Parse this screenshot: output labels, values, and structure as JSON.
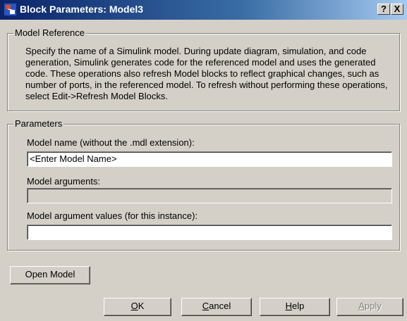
{
  "window": {
    "title": "Block Parameters: Model3",
    "help_button": "?",
    "close_button": "X"
  },
  "model_reference": {
    "legend": "Model Reference",
    "description": "Specify the name of a Simulink model. During update diagram, simulation, and code generation, Simulink generates code for the referenced model and uses the generated code. These operations also refresh Model blocks to reflect graphical changes, such as number of ports, in the referenced model. To refresh without performing these operations, select Edit->Refresh Model Blocks."
  },
  "parameters": {
    "legend": "Parameters",
    "model_name_label": "Model name (without the .mdl extension):",
    "model_name_value": "<Enter Model Name>",
    "model_arguments_label": "Model arguments:",
    "model_arguments_value": "",
    "model_argument_values_label": "Model argument values (for this instance):",
    "model_argument_values_value": ""
  },
  "buttons": {
    "open_model": "Open Model",
    "ok_mnemonic": "O",
    "ok_rest": "K",
    "cancel_mnemonic": "C",
    "cancel_rest": "ancel",
    "help_mnemonic": "H",
    "help_rest": "elp",
    "apply_mnemonic": "A",
    "apply_rest": "pply"
  },
  "icons": {
    "app_icon": "simulink-block-icon"
  }
}
